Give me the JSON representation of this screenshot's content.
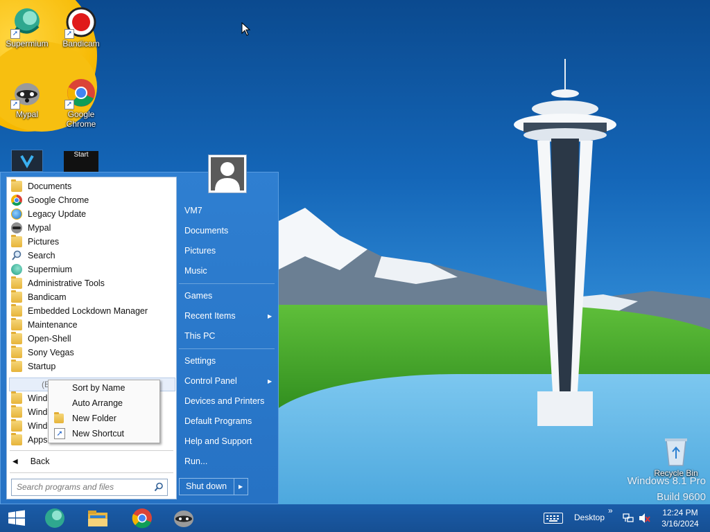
{
  "desktop": {
    "icons": [
      {
        "label": "Supermium",
        "icon": "supermium-icon"
      },
      {
        "label": "Bandicam",
        "icon": "bandicam-icon"
      },
      {
        "label": "Mypal",
        "icon": "mypal-icon"
      },
      {
        "label": "Google Chrome",
        "label_line1": "Google",
        "label_line2": "Chrome",
        "icon": "chrome-icon"
      },
      {
        "label": "Recycle Bin",
        "icon": "recycle-bin-icon"
      }
    ],
    "watermark": {
      "line1": "Windows 8.1 Pro",
      "line2": "Build 9600"
    },
    "partial_icon_label": "Start"
  },
  "start_menu": {
    "programs": [
      {
        "label": "Documents",
        "icon": "folder-docs-icon"
      },
      {
        "label": "Google Chrome",
        "icon": "chrome-icon"
      },
      {
        "label": "Legacy Update",
        "icon": "legacy-update-icon"
      },
      {
        "label": "Mypal",
        "icon": "mypal-icon"
      },
      {
        "label": "Pictures",
        "icon": "folder-pictures-icon"
      },
      {
        "label": "Search",
        "icon": "search-icon"
      },
      {
        "label": "Supermium",
        "icon": "supermium-icon"
      },
      {
        "label": "Administrative Tools",
        "icon": "folder-icon"
      },
      {
        "label": "Bandicam",
        "icon": "folder-icon"
      },
      {
        "label": "Embedded Lockdown Manager",
        "icon": "folder-icon"
      },
      {
        "label": "Maintenance",
        "icon": "folder-icon"
      },
      {
        "label": "Open-Shell",
        "icon": "folder-icon"
      },
      {
        "label": "Sony Vegas",
        "icon": "folder-icon"
      },
      {
        "label": "Startup",
        "icon": "folder-icon"
      }
    ],
    "empty_row": "(Empty)",
    "truncated_rows": [
      "Windo",
      "Windo",
      "Windo",
      "Apps"
    ],
    "back_label": "Back",
    "search_placeholder": "Search programs and files",
    "context_menu": {
      "items": [
        "Sort by Name",
        "Auto Arrange",
        "New Folder",
        "New Shortcut"
      ]
    },
    "right_pane": {
      "user": "VM7",
      "group1": [
        "Documents",
        "Pictures",
        "Music"
      ],
      "group2": [
        {
          "label": "Games",
          "submenu": false
        },
        {
          "label": "Recent Items",
          "submenu": true
        },
        {
          "label": "This PC",
          "submenu": false
        }
      ],
      "group3": [
        {
          "label": "Settings",
          "submenu": false
        },
        {
          "label": "Control Panel",
          "submenu": true
        },
        {
          "label": "Devices and Printers",
          "submenu": false
        },
        {
          "label": "Default Programs",
          "submenu": false
        },
        {
          "label": "Help and Support",
          "submenu": false
        },
        {
          "label": "Run...",
          "submenu": false
        }
      ],
      "shutdown_label": "Shut down"
    }
  },
  "taskbar": {
    "pinned": [
      "start-button",
      "supermium-icon",
      "file-explorer-icon",
      "chrome-icon",
      "mypal-icon"
    ],
    "desktop_toolbar": "Desktop",
    "overflow": "»",
    "clock_time": "12:24 PM",
    "clock_date": "3/16/2024"
  },
  "colors": {
    "start_menu_bg": "#2b78c9",
    "taskbar_bg": "#17549a",
    "accent_yellow": "#f6b800"
  }
}
